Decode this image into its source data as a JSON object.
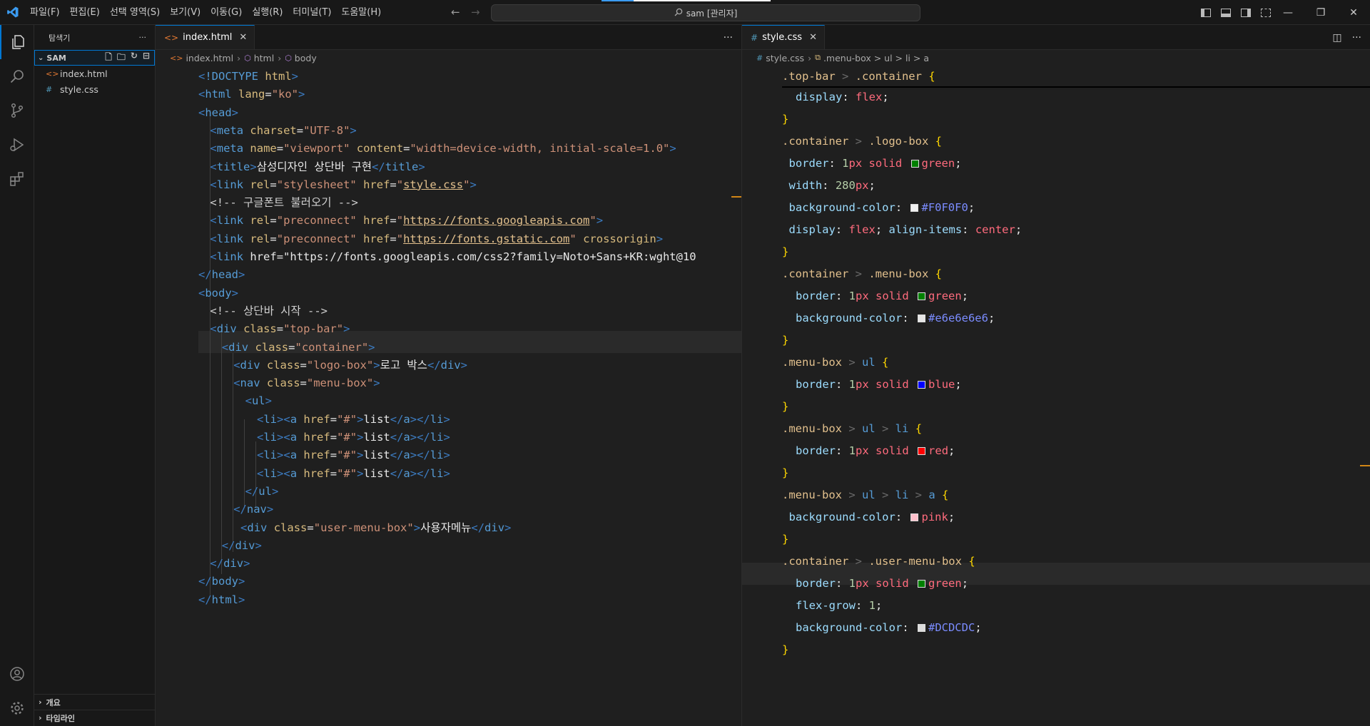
{
  "titlebar": {
    "menu": [
      "파일(F)",
      "편집(E)",
      "선택 영역(S)",
      "보기(V)",
      "이동(G)",
      "실행(R)",
      "터미널(T)",
      "도움말(H)"
    ],
    "search": "sam [관리자]",
    "controls": {
      "minimize": "—",
      "restore": "❐",
      "close": "✕"
    }
  },
  "sidebar": {
    "title": "탐색기",
    "more": "···",
    "folder": "SAM",
    "files": [
      {
        "name": "index.html",
        "icon": "html-file-icon"
      },
      {
        "name": "style.css",
        "icon": "css-file-icon"
      }
    ],
    "outline": "개요",
    "timeline": "타임라인"
  },
  "left_editor": {
    "tab": "index.html",
    "crumbs": [
      "index.html",
      "html",
      "body"
    ],
    "lines": [
      "<!DOCTYPE html>",
      "<html lang=\"ko\">",
      "<head>",
      "<meta charset=\"UTF-8\">",
      "<meta name=\"viewport\" content=\"width=device-width, initial-scale=1.0\">",
      "<title>삼성디자인 상단바 구현</title>",
      "<link rel=\"stylesheet\" href=\"style.css\">",
      "<!-- 구글폰트 불러오기 -->",
      "<link rel=\"preconnect\" href=\"https://fonts.googleapis.com\">",
      "<link rel=\"preconnect\" href=\"https://fonts.gstatic.com\" crossorigin>",
      "<link href=\"https://fonts.googleapis.com/css2?family=Noto+Sans+KR:wght@10",
      "</head>",
      "<body>",
      "<!-- 상단바 시작 -->",
      "<div class=\"top-bar\">",
      "<div class=\"container\">",
      "<div class=\"logo-box\">로고 박스</div>",
      "<nav class=\"menu-box\">",
      "<ul>",
      "<li><a href=\"#\">list</a></li>",
      "<li><a href=\"#\">list</a></li>",
      "<li><a href=\"#\">list</a></li>",
      "<li><a href=\"#\">list</a></li>",
      "</ul>",
      "</nav>",
      "<div class=\"user-menu-box\">사용자메뉴</div>",
      "</div>",
      "</div>",
      "</body>",
      "</html>"
    ]
  },
  "right_editor": {
    "tab": "style.css",
    "crumbs": [
      "style.css",
      ".menu-box > ul > li > a"
    ],
    "sticky": ".top-bar > .container{",
    "lines": [
      "display: flex;",
      "}",
      ".container > .logo-box{",
      "border: 1px solid green;",
      "width: 280px;",
      "background-color: #F0F0F0;",
      "display: flex; align-items: center;",
      "}",
      ".container > .menu-box{",
      "border: 1px solid green;",
      "background-color: #e6e6e6e6;",
      "}",
      ".menu-box > ul {",
      "border: 1px solid blue;",
      "}",
      ".menu-box > ul > li {",
      "border: 1px solid red;",
      "}",
      ".menu-box > ul > li > a {",
      "background-color: pink;",
      "}",
      ".container > .user-menu-box{",
      "border: 1px solid green;",
      "flex-grow: 1;",
      "background-color: #DCDCDC;",
      "}"
    ]
  },
  "colors": {
    "accent": "#0078d4",
    "swatch_green": "#008000",
    "swatch_f0": "#F0F0F0",
    "swatch_e6": "#e6e6e6",
    "swatch_blue": "#0000ff",
    "swatch_red": "#ff0000",
    "swatch_pink": "#ffc0cb",
    "swatch_dc": "#DCDCDC"
  }
}
